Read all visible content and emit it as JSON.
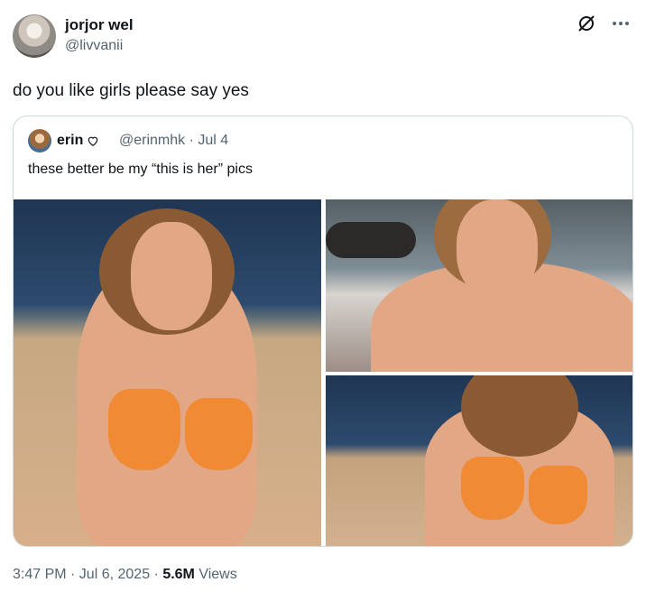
{
  "author": {
    "name": "jorjor wel",
    "handle": "@livvanii"
  },
  "tweet": {
    "text": "do you like girls please say yes"
  },
  "quote": {
    "name": "erin",
    "verified_icon": "heart-icon",
    "handle": "@erinmhk",
    "date": "· Jul 4",
    "text": "these better be my “this is her” pics"
  },
  "meta": {
    "time": "3:47 PM · Jul 6, 2025 · ",
    "views_count": "5.6M",
    "views_label": " Views"
  },
  "icons": [
    "grok-icon",
    "more-icon"
  ]
}
